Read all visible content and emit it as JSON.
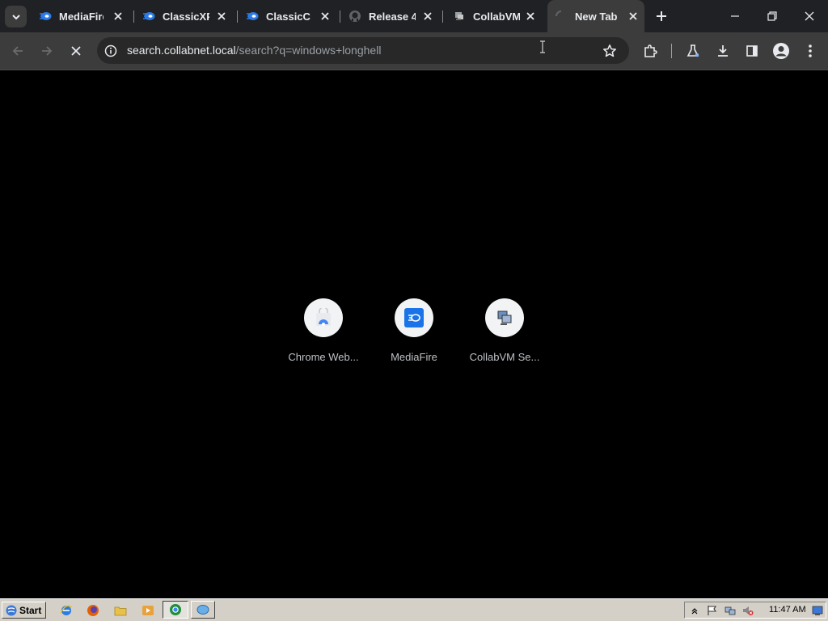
{
  "tabs": [
    {
      "title": "MediaFire",
      "icon": "mediafire-icon",
      "active": false
    },
    {
      "title": "ClassicXP",
      "icon": "mediafire-icon",
      "active": false
    },
    {
      "title": "ClassicC",
      "icon": "mediafire-icon",
      "active": false
    },
    {
      "title": "Release 4.",
      "icon": "github-icon",
      "active": false
    },
    {
      "title": "CollabVM",
      "icon": "collabvm-icon",
      "active": false
    },
    {
      "title": "New Tab",
      "icon": "loading-spinner-icon",
      "active": true
    }
  ],
  "address_bar": {
    "host": "search.collabnet.local",
    "path": "/search?q=windows+longhell"
  },
  "shortcuts": [
    {
      "label": "Chrome Web...",
      "icon": "chrome-web-store-icon"
    },
    {
      "label": "MediaFire",
      "icon": "mediafire-icon"
    },
    {
      "label": "CollabVM Se...",
      "icon": "collabvm-icon"
    }
  ],
  "taskbar": {
    "start_label": "Start",
    "clock": "11:47 AM"
  },
  "colors": {
    "tabstrip": "#202124",
    "toolbar": "#3c3c3c",
    "omnibox": "#282828",
    "page_background": "#000000",
    "mediafire_blue": "#1a73e8",
    "taskbar": "#d4d0c8"
  }
}
